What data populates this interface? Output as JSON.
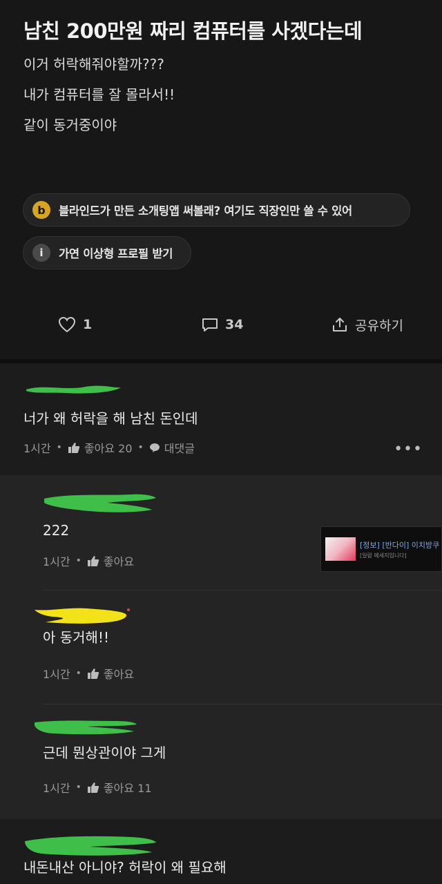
{
  "post": {
    "title": "남친 200만원 짜리 컴퓨터를 사겠다는데",
    "body": [
      "이거 허락해줘야할까???",
      "내가 컴퓨터를 잘 몰라서!!",
      "같이 동거중이야"
    ]
  },
  "chips": [
    {
      "icon": "b",
      "label": "블라인드가 만든 소개팅앱 써볼래? 여기도 직장인만 쓸 수 있어"
    },
    {
      "icon": "i",
      "label": "가연 이상형 프로필 받기"
    }
  ],
  "actions": {
    "likes": "1",
    "comments": "34",
    "share_label": "공유하기"
  },
  "comment": {
    "text": "너가 왜 허락을 해 남친 돈인데",
    "time": "1시간",
    "like_label": "좋아요 20",
    "reply_label": "대댓글",
    "more": "•••"
  },
  "replies": [
    {
      "text": "222",
      "time": "1시간",
      "like_label": "좋아요",
      "scribble_color": "#3fbf4a"
    },
    {
      "text": "아 동거해!!",
      "time": "1시간",
      "like_label": "좋아요",
      "scribble_color": "#f2e21a"
    },
    {
      "text": "근데 뭔상관이야 그게",
      "time": "1시간",
      "like_label": "좋아요 11",
      "scribble_color": "#3fbf4a"
    }
  ],
  "last_comment": {
    "text": "내돈내산 아니야? 허락이 왜 필요해",
    "scribble_color": "#3fbf4a"
  },
  "ad": {
    "title": "[정보] [반다이] 이치방쿠",
    "subtitle": "[일람 메세지입니다]"
  },
  "colors": {
    "accent_badge": "#d9a520",
    "scribble_green": "#3fbf4a",
    "scribble_yellow": "#f2e21a"
  }
}
